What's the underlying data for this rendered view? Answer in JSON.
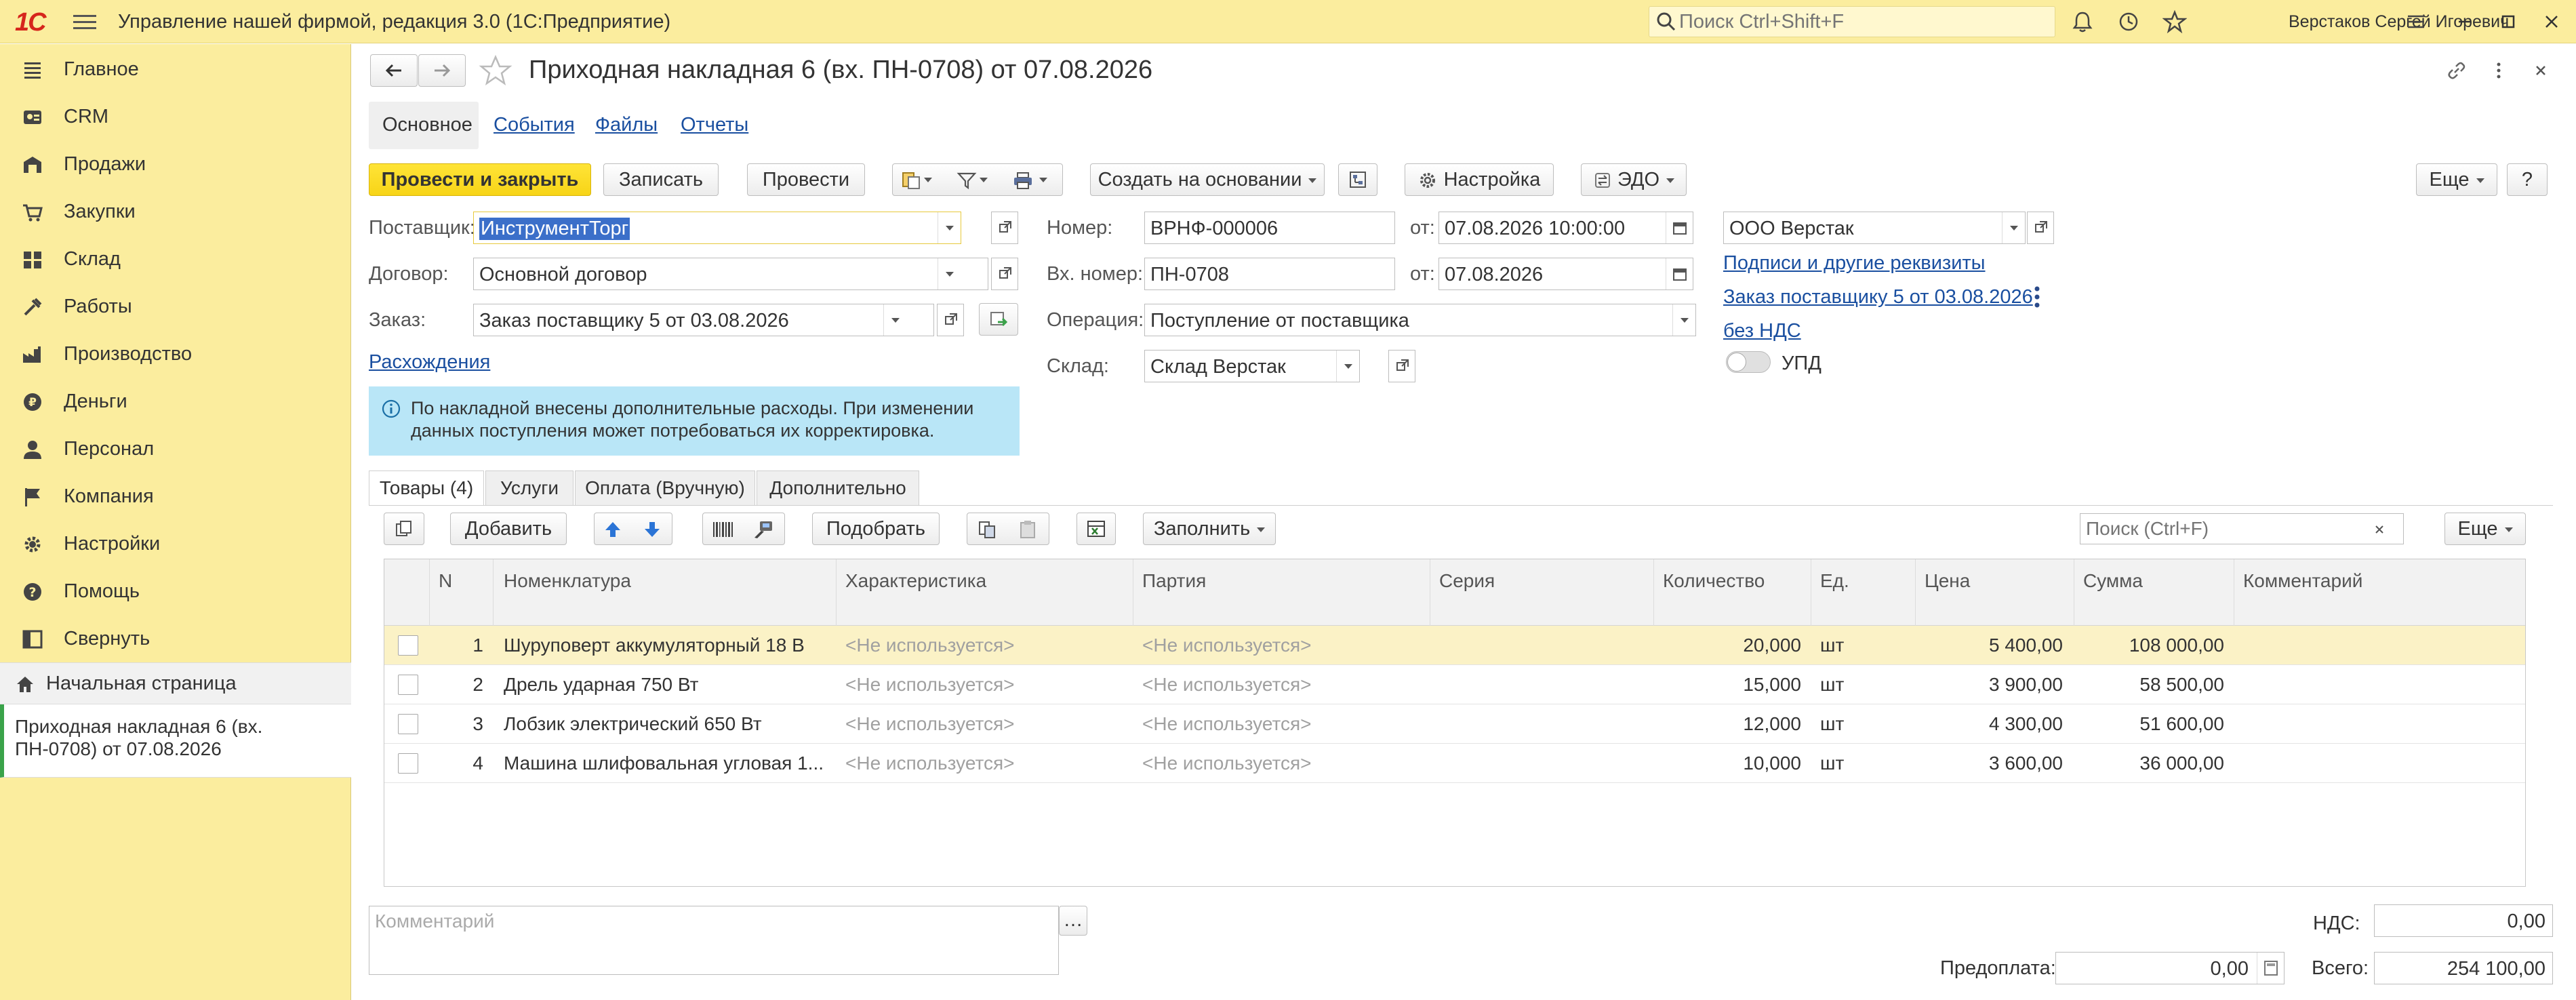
{
  "app": {
    "logo_text": "1С",
    "title": "Управление нашей фирмой, редакция 3.0  (1С:Предприятие)",
    "search_placeholder": "Поиск Ctrl+Shift+F",
    "user": "Верстаков Сергей Игоревич"
  },
  "sidebar": {
    "items": [
      {
        "label": "Главное",
        "icon": "list-icon"
      },
      {
        "label": "CRM",
        "icon": "crm-icon"
      },
      {
        "label": "Продажи",
        "icon": "sales-icon"
      },
      {
        "label": "Закупки",
        "icon": "purchases-icon"
      },
      {
        "label": "Склад",
        "icon": "warehouse-icon"
      },
      {
        "label": "Работы",
        "icon": "works-icon"
      },
      {
        "label": "Производство",
        "icon": "production-icon"
      },
      {
        "label": "Деньги",
        "icon": "money-icon"
      },
      {
        "label": "Персонал",
        "icon": "personnel-icon"
      },
      {
        "label": "Компания",
        "icon": "flag-icon"
      },
      {
        "label": "Настройки",
        "icon": "gear-icon"
      },
      {
        "label": "Помощь",
        "icon": "help-icon"
      },
      {
        "label": "Свернуть",
        "icon": "collapse-icon"
      }
    ],
    "home": "Начальная страница",
    "open_document": "Приходная накладная 6 (вх. ПН-0708) от 07.08.2026"
  },
  "document": {
    "title": "Приходная накладная 6 (вх. ПН-0708) от 07.08.2026",
    "tabs": [
      "Основное",
      "События",
      "Файлы",
      "Отчеты"
    ],
    "toolbar": {
      "post_close": "Провести и закрыть",
      "save": "Записать",
      "post": "Провести",
      "create_based": "Создать на основании",
      "settings": "Настройка",
      "edo": "ЭДО",
      "more": "Еще",
      "help": "?"
    },
    "fields": {
      "supplier_label": "Поставщик:",
      "supplier": "ИнструментТорг",
      "contract_label": "Договор:",
      "contract": "Основной договор",
      "order_label": "Заказ:",
      "order": "Заказ поставщику 5 от 03.08.2026",
      "discrepancies": "Расхождения",
      "number_label": "Номер:",
      "number": "ВРНФ-000006",
      "from_label": "от:",
      "date": "07.08.2026 10:00:00",
      "in_number_label": "Вх. номер:",
      "in_number": "ПН-0708",
      "in_date": "07.08.2026",
      "operation_label": "Операция:",
      "operation": "Поступление от поставщика",
      "warehouse_label": "Склад:",
      "warehouse": "Склад Верстак",
      "company": "ООО Верстак",
      "signatures_link": "Подписи и другие реквизиты",
      "order_link": "Заказ поставщику 5 от 03.08.2026",
      "vat_link": "без НДС",
      "upd_label": "УПД"
    },
    "info_message": "По накладной внесены дополнительные расходы. При изменении данных поступления может потребоваться их корректировка.",
    "inner_tabs": [
      "Товары (4)",
      "Услуги",
      "Оплата (Вручную)",
      "Дополнительно"
    ],
    "table_toolbar": {
      "add": "Добавить",
      "pick": "Подобрать",
      "fill": "Заполнить",
      "search_placeholder": "Поиск (Ctrl+F)",
      "more": "Еще"
    },
    "columns": [
      "N",
      "Номенклатура",
      "Характеристика",
      "Партия",
      "Серия",
      "Количество",
      "Ед.",
      "Цена",
      "Сумма",
      "Комментарий"
    ],
    "rows": [
      {
        "n": "1",
        "name": "Шуруповерт аккумуляторный 18 В",
        "characteristic": "<Не используется>",
        "batch": "<Не используется>",
        "series": "",
        "qty": "20,000",
        "unit": "шт",
        "price": "5 400,00",
        "sum": "108 000,00",
        "comment": ""
      },
      {
        "n": "2",
        "name": "Дрель ударная 750 Вт",
        "characteristic": "<Не используется>",
        "batch": "<Не используется>",
        "series": "",
        "qty": "15,000",
        "unit": "шт",
        "price": "3 900,00",
        "sum": "58 500,00",
        "comment": ""
      },
      {
        "n": "3",
        "name": "Лобзик электрический 650 Вт",
        "characteristic": "<Не используется>",
        "batch": "<Не используется>",
        "series": "",
        "qty": "12,000",
        "unit": "шт",
        "price": "4 300,00",
        "sum": "51 600,00",
        "comment": ""
      },
      {
        "n": "4",
        "name": "Машина шлифовальная угловая 1...",
        "characteristic": "<Не используется>",
        "batch": "<Не используется>",
        "series": "",
        "qty": "10,000",
        "unit": "шт",
        "price": "3 600,00",
        "sum": "36 000,00",
        "comment": ""
      }
    ],
    "footer": {
      "comment_placeholder": "Комментарий",
      "vat_label": "НДС:",
      "vat": "0,00",
      "prepay_label": "Предоплата:",
      "prepay": "0,00",
      "total_label": "Всего:",
      "total": "254 100,00"
    }
  },
  "colors": {
    "sidebar_bg": "#fbed9e",
    "primary_button": "#f7d417",
    "link": "#1a4fa0",
    "info_bg": "#b9e6f7",
    "selected_row": "#fbf2c6"
  }
}
